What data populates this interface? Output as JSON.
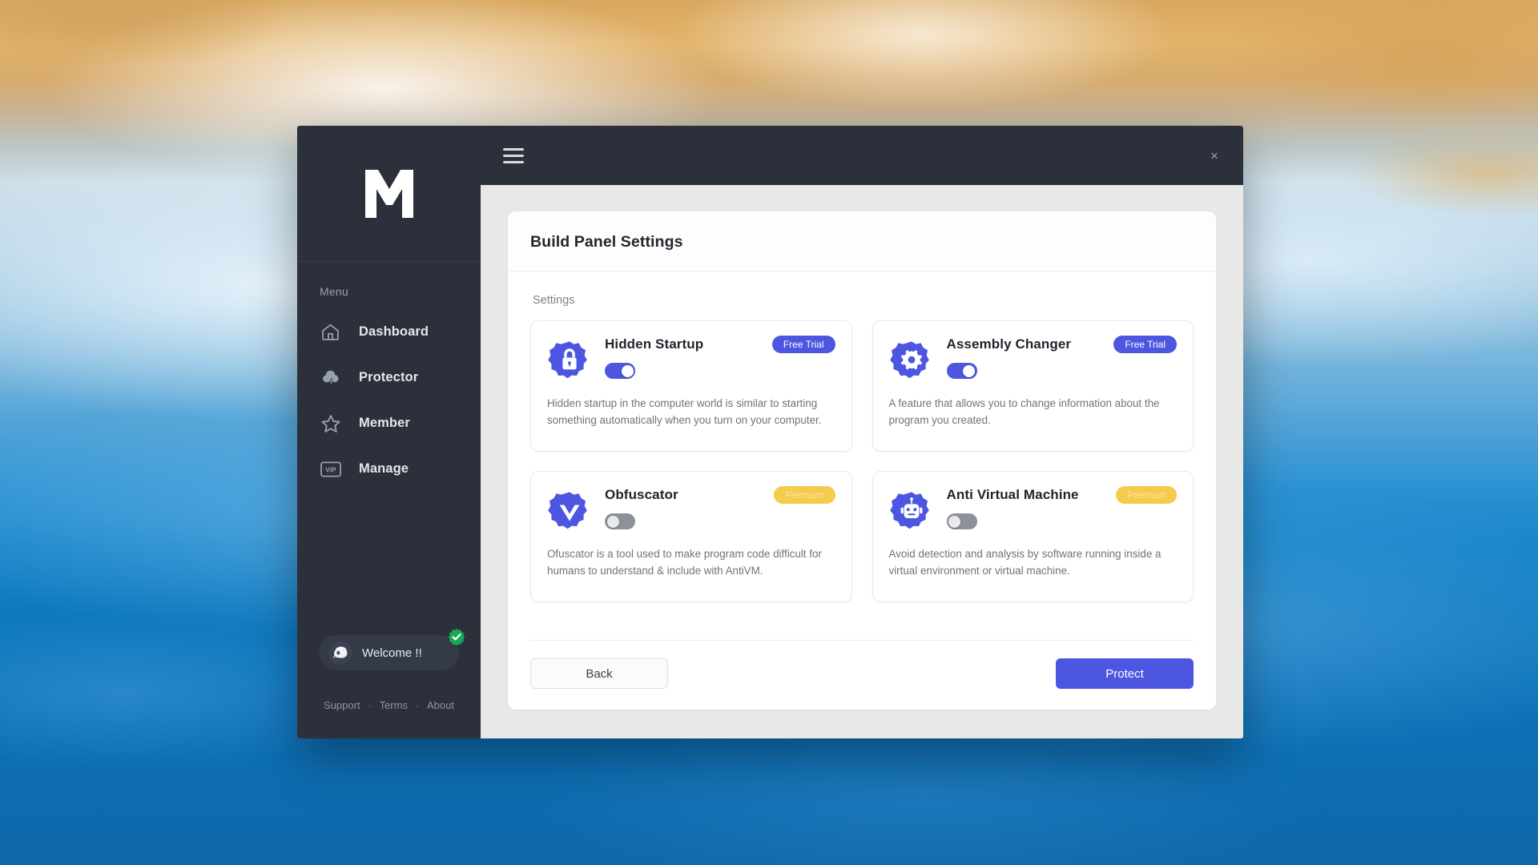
{
  "window": {
    "close_label": "×",
    "hamburger_name": "menu-toggle"
  },
  "sidebar": {
    "logo_alt": "M logo",
    "menu_heading": "Menu",
    "items": [
      {
        "label": "Dashboard",
        "icon": "home-icon"
      },
      {
        "label": "Protector",
        "icon": "cloud-bolt-icon"
      },
      {
        "label": "Member",
        "icon": "star-icon"
      },
      {
        "label": "Manage",
        "icon": "vip-badge-icon"
      }
    ],
    "account": {
      "welcome_text": "Welcome !!",
      "avatar_icon": "avatar-icon",
      "verified_icon": "verified-check-icon"
    },
    "footer_links": [
      {
        "label": "Support"
      },
      {
        "label": "Terms"
      },
      {
        "label": "About"
      }
    ],
    "footer_separator": "·"
  },
  "panel": {
    "title": "Build Panel Settings",
    "section_label": "Settings",
    "cards": [
      {
        "title": "Hidden Startup",
        "badge": "Free Trial",
        "badge_type": "free",
        "toggle_on": true,
        "icon": "lock-badge-icon",
        "description": "Hidden startup in the computer world is similar to starting something automatically when you turn on your computer."
      },
      {
        "title": "Assembly Changer",
        "badge": "Free Trial",
        "badge_type": "free",
        "toggle_on": true,
        "icon": "gear-badge-icon",
        "description": "A feature that allows you to change information about the program you created."
      },
      {
        "title": "Obfuscator",
        "badge": "Premium",
        "badge_type": "premium",
        "toggle_on": false,
        "icon": "chevron-badge-icon",
        "description": "Ofuscator is a tool used to make program code difficult for humans to understand & include with AntiVM."
      },
      {
        "title": "Anti Virtual Machine",
        "badge": "Premium",
        "badge_type": "premium",
        "toggle_on": false,
        "icon": "robot-badge-icon",
        "description": "Avoid detection and analysis by software running inside a virtual environment or virtual machine."
      }
    ],
    "back_label": "Back",
    "protect_label": "Protect"
  },
  "colors": {
    "accent": "#4c56e0",
    "premium": "#f5cb4b",
    "sidebar_bg": "#2b303b",
    "panel_bg": "#e8e8e6"
  }
}
